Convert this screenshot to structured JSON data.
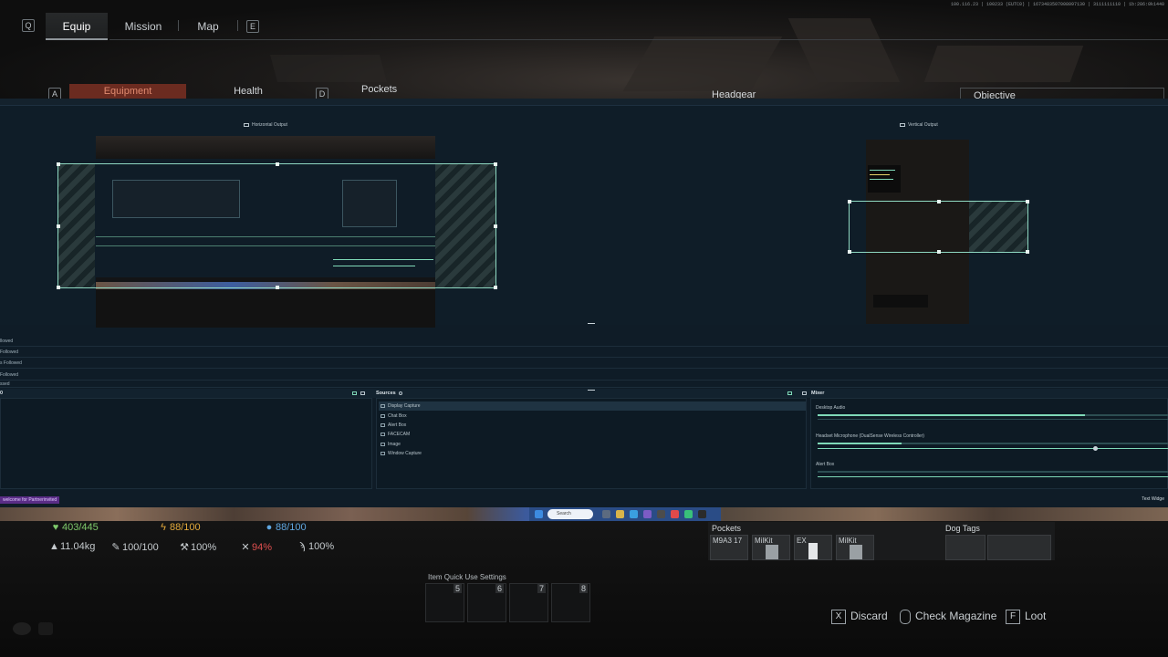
{
  "game": {
    "nav": {
      "key_left": "Q",
      "key_right": "E",
      "tabs": [
        "Equip",
        "Mission",
        "Map"
      ]
    },
    "system_line": "100.116.23 | 100233 (EUTC0) | 1673483507008097130 | 3111111110 | 1b:286:0k1440",
    "subnav": {
      "key_a": "A",
      "key_d": "D",
      "tabs": [
        "Equipment",
        "Health",
        "Pockets",
        "Headgear",
        "Objective"
      ]
    },
    "stats": {
      "health": "403/445",
      "energy": "88/100",
      "hydration": "88/100",
      "weight": "11.04kg",
      "stat2": "100/100",
      "stat3": "100%",
      "stat4": "94%",
      "stat5": "100%"
    },
    "pockets": {
      "title": "Pockets",
      "slots": [
        "M9A3 17",
        "MilKit",
        "EX",
        "MilKit"
      ],
      "dog_tags_title": "Dog Tags"
    },
    "quick_use": {
      "title": "Item Quick Use Settings",
      "slots": [
        "5",
        "6",
        "7",
        "8"
      ]
    },
    "prompts": [
      {
        "key": "X",
        "label": "Discard"
      },
      {
        "key": "",
        "label": "Check Magazine"
      },
      {
        "key": "F",
        "label": "Loot"
      }
    ]
  },
  "obs": {
    "horizontal_output_label": "Horizontal Output",
    "vertical_output_label": "Vertical Output",
    "scene_rows": [
      "llowed",
      "Followed",
      "s Followed",
      "Followed",
      "ssed"
    ],
    "sources_title": "Sources",
    "sources": [
      "Display Capture",
      "Chat Box",
      "Alert Box",
      "FACECAM",
      "Image",
      "Window Capture"
    ],
    "mixer_title": "Mixer",
    "mixer_channels": [
      {
        "name": "Desktop Audio",
        "level": 0.76
      },
      {
        "name": "Headset Microphone (DualSense Wireless Controller)",
        "level": 0.24
      },
      {
        "name": "Alert Box",
        "level": 0.0
      }
    ],
    "follower_label": "welcome for Partnerinvited",
    "text_widget_label": "Text Widge"
  },
  "taskbar": {
    "search_placeholder": "Search"
  }
}
